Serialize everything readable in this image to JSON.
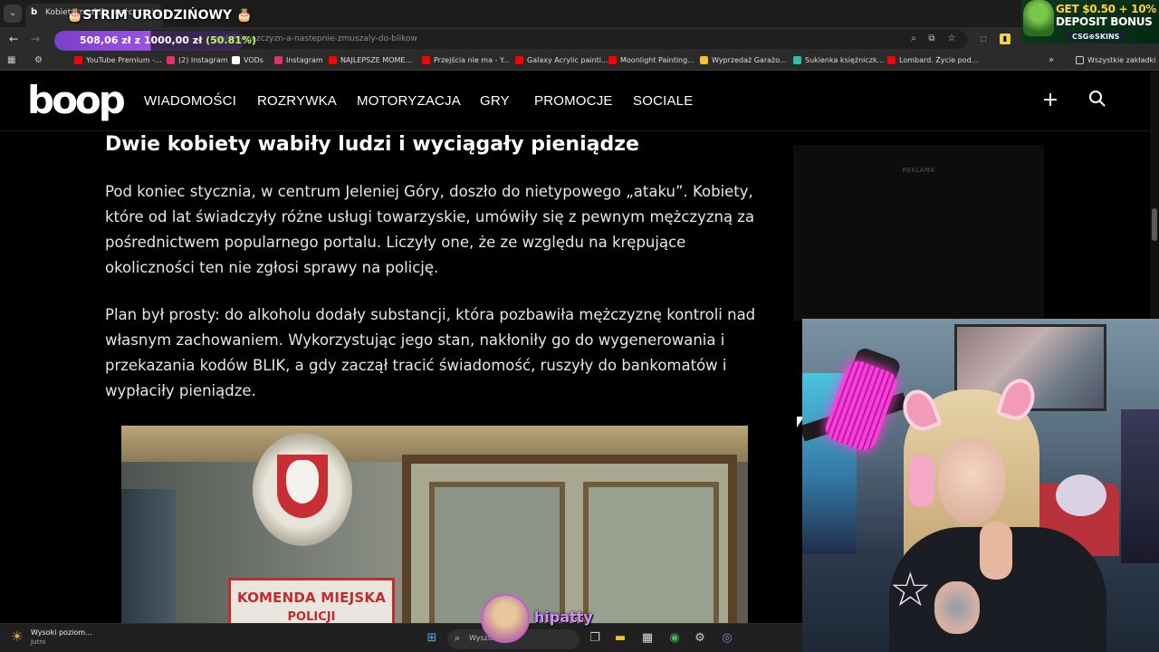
{
  "stream_overlay": {
    "title": "🎂STRIM URODZIŃOWY 🎂",
    "goal_current": "508,06 zł",
    "goal_separator": "z",
    "goal_target": "1000,00 zł",
    "goal_percent": "(50.81%)",
    "goal_fraction": 0.5081,
    "streamer_name": "hipatty"
  },
  "promo": {
    "line1_accent": "GET $0.50 + 10%",
    "line2": "DEPOSIT BONUS",
    "brand": "CSG⊕SKINS"
  },
  "browser": {
    "tab_title": "Kobiety zwabiły mężczyzn...",
    "favicon": "b",
    "url": "...wabily-mezczyzn-a-nastepnie-zmuszaly-do-blikow",
    "bookmarks": [
      {
        "label": "YouTube Premium -...",
        "color": "#ff0000"
      },
      {
        "label": "(2) Instagram",
        "color": "#e1306c"
      },
      {
        "label": "VODs",
        "color": "#ffffff"
      },
      {
        "label": "Instagram",
        "color": "#e1306c"
      },
      {
        "label": "NAJLEPSZE MOME...",
        "color": "#ff0000"
      },
      {
        "label": "Przejścia nie ma - Y...",
        "color": "#ff0000"
      },
      {
        "label": "Galaxy Acrylic painti...",
        "color": "#ff0000"
      },
      {
        "label": "Moonlight Painting...",
        "color": "#ff0000"
      },
      {
        "label": "Wyprzedaż Garażo...",
        "color": "#f6c026"
      },
      {
        "label": "Sukienka księżniczk...",
        "color": "#2cbeb0"
      },
      {
        "label": "Lombard. Życie pod...",
        "color": "#ff0000"
      }
    ],
    "all_bookmarks": "Wszystkie zakładki"
  },
  "site": {
    "logo": "boop",
    "nav": [
      "WIADOMOŚCI",
      "ROZRYWKA",
      "MOTORYZACJA",
      "GRY",
      "PROMOCJE",
      "SOCIALE"
    ],
    "ad_label": "REKLAMA"
  },
  "article": {
    "heading": "Dwie kobiety wabiły ludzi i wyciągały pieniądze",
    "paragraph1": "Pod koniec stycznia, w centrum Jeleniej Góry, doszło do nietypowego „ataku”. Kobiety, które od lat świadczyły różne usługi towarzyskie, umówiły się z pewnym mężczyzną za pośrednictwem popularnego portalu. Liczyły one, że ze względu na krępujące okoliczności ten nie zgłosi sprawy na policję.",
    "paragraph2": "Plan był prosty: do alkoholu dodały substancji, która pozbawiła mężczyznę kontroli nad własnym zachowaniem. Wykorzystując jego stan, nakłoniły go do wygenerowania i przekazania kodów BLIK, a gdy zaczął tracić świadomość, ruszyły do bankomatów i wypłaciły pieniądze.",
    "photo_sign": "KOMENDA MIEJSKA",
    "photo_sign2": "POLICJI"
  },
  "taskbar": {
    "weather_title": "Wysoki poziom...",
    "weather_sub": "Jutro",
    "search_text": "Wyszukaj"
  }
}
